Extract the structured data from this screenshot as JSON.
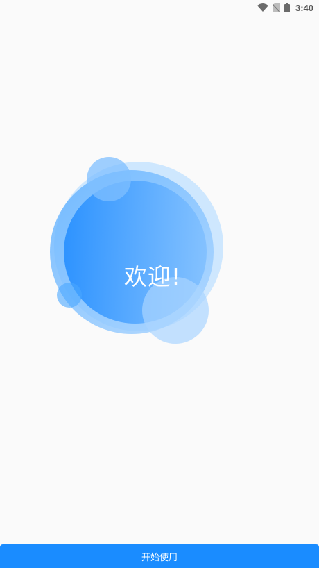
{
  "status_bar": {
    "time": "3:40",
    "icons": [
      "wifi-icon",
      "no-sim-icon",
      "battery-icon"
    ]
  },
  "welcome": {
    "text": "欢迎!"
  },
  "start_button": {
    "label": "开始使用"
  },
  "colors": {
    "background": "#fafafa",
    "accent": "#1a8cff",
    "bubble_light": "#9fd0ff",
    "bubble_dark": "#2b93ff"
  }
}
